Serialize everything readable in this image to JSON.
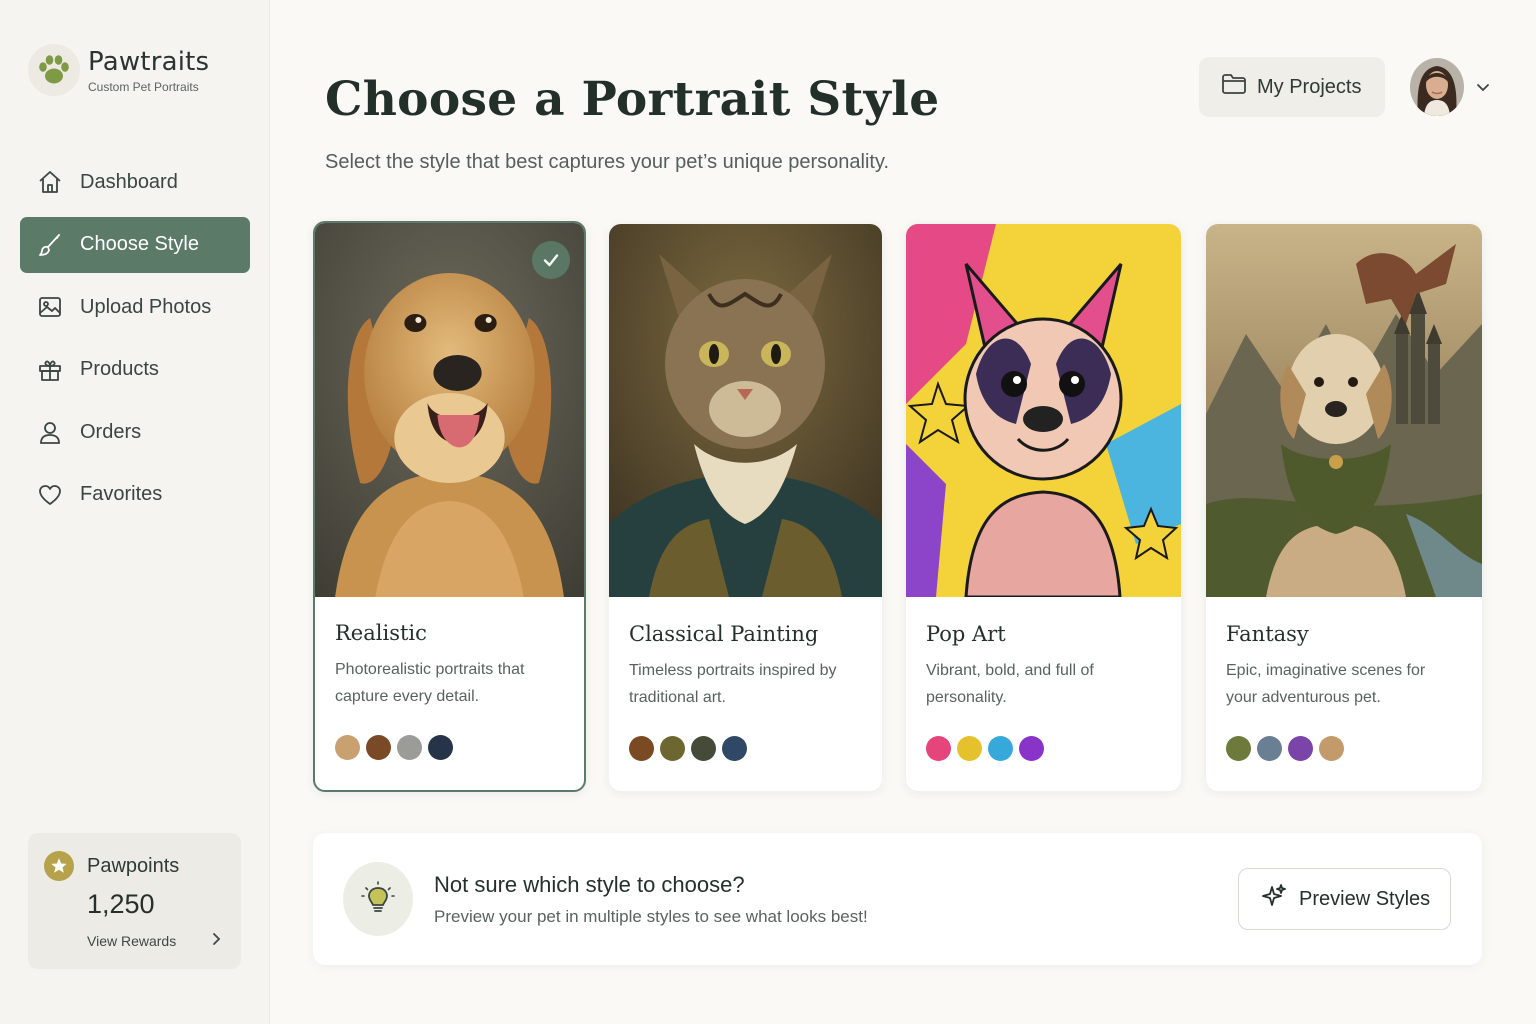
{
  "brand": {
    "name": "Pawtraits",
    "tagline": "Custom Pet Portraits",
    "logo_icon": "paw-icon"
  },
  "nav": {
    "items": [
      {
        "label": "Dashboard",
        "icon": "home-icon",
        "active": false
      },
      {
        "label": "Choose Style",
        "icon": "brush-icon",
        "active": true
      },
      {
        "label": "Upload Photos",
        "icon": "image-icon",
        "active": false
      },
      {
        "label": "Products",
        "icon": "gift-icon",
        "active": false
      },
      {
        "label": "Orders",
        "icon": "user-icon",
        "active": false
      },
      {
        "label": "Favorites",
        "icon": "heart-icon",
        "active": false
      }
    ]
  },
  "points": {
    "label": "Pawpoints",
    "value": "1,250",
    "link": "View Rewards"
  },
  "header": {
    "title": "Choose a Portrait Style",
    "subtitle": "Select the style that best captures your pet’s unique personality.",
    "projects_label": "My Projects"
  },
  "styles": [
    {
      "title": "Realistic",
      "description": "Photorealistic portraits that capture every detail.",
      "selected": true,
      "swatches": [
        "#c9a06f",
        "#7a4a26",
        "#9b9b98",
        "#263449"
      ]
    },
    {
      "title": "Classical Painting",
      "description": "Timeless portraits inspired by traditional art.",
      "selected": false,
      "swatches": [
        "#7a4a22",
        "#6e6631",
        "#454a39",
        "#2f4866"
      ]
    },
    {
      "title": "Pop Art",
      "description": "Vibrant, bold, and full of personality.",
      "selected": false,
      "swatches": [
        "#e5457a",
        "#e6c12e",
        "#36a9da",
        "#8a33c9"
      ]
    },
    {
      "title": "Fantasy",
      "description": "Epic, imaginative scenes for your adventurous pet.",
      "selected": false,
      "swatches": [
        "#6d7a3c",
        "#6a7f93",
        "#7b44a8",
        "#c39a6a"
      ]
    }
  ],
  "tip": {
    "title": "Not sure which style to choose?",
    "text": "Preview your pet in multiple styles to see what looks best!",
    "button": "Preview Styles"
  },
  "colors": {
    "accent": "#5b7a67",
    "background": "#faf9f6",
    "sidebar": "#f5f4f0",
    "gold": "#b5a24a"
  }
}
